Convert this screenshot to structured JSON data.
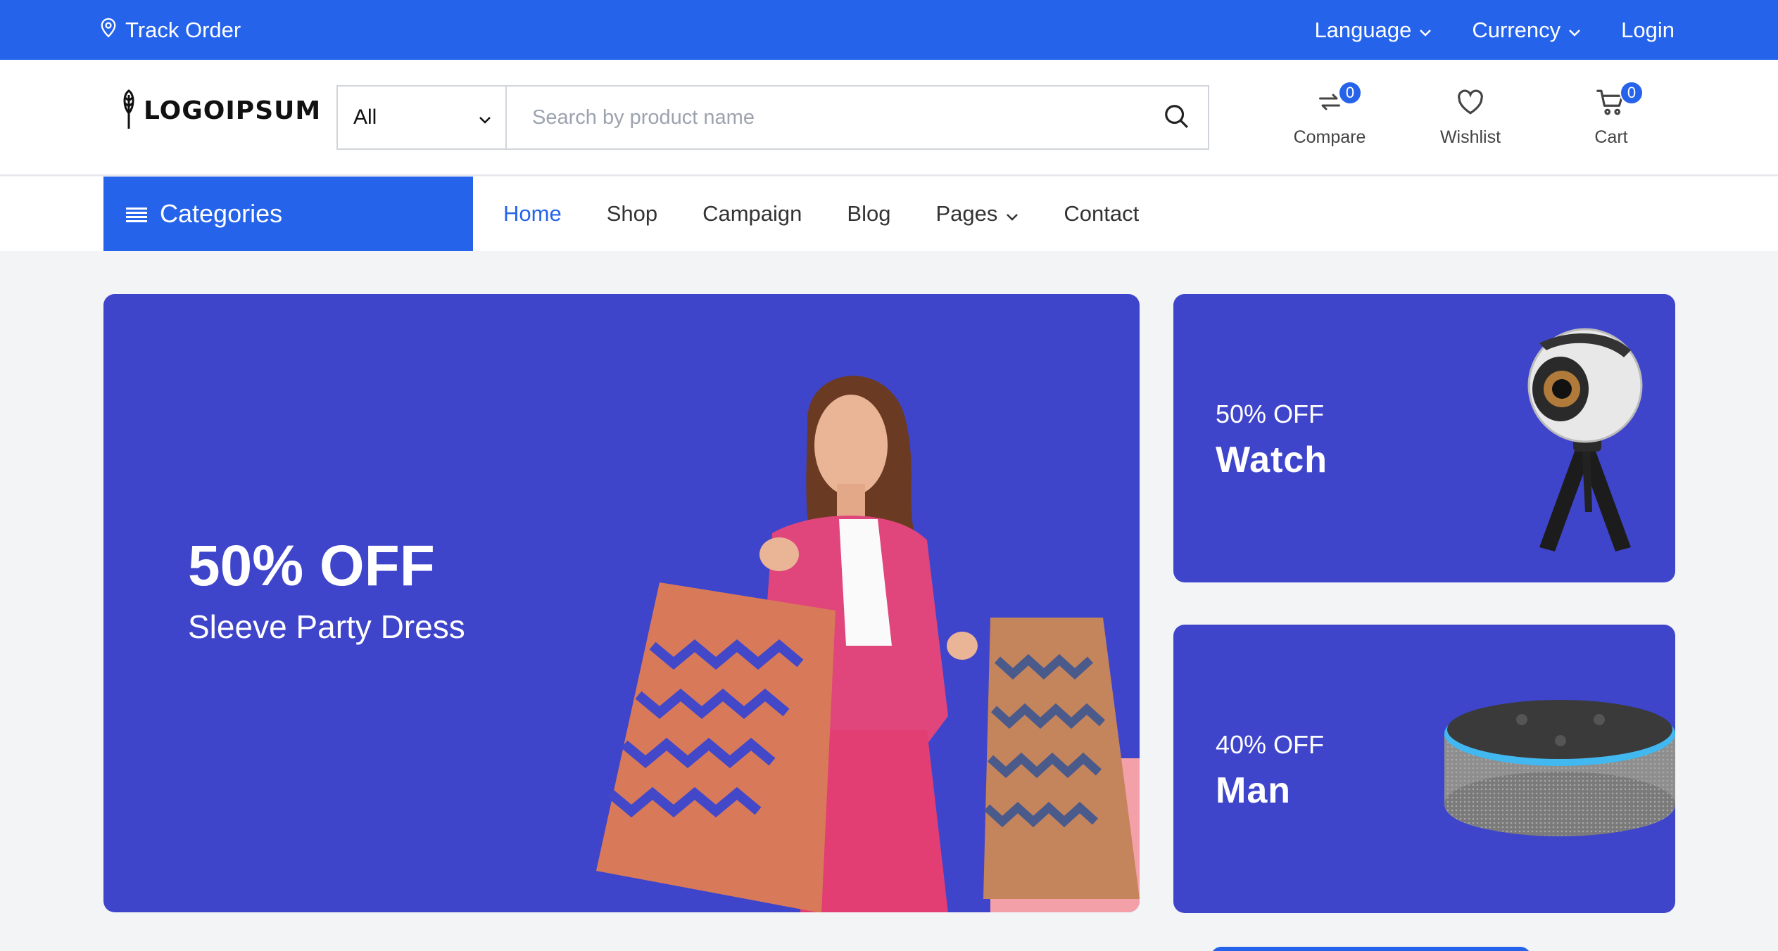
{
  "topbar": {
    "track_order": "Track Order",
    "language": "Language",
    "currency": "Currency",
    "login": "Login"
  },
  "header": {
    "logo_text": "LOGOIPSUM",
    "search": {
      "category": "All",
      "placeholder": "Search by product name"
    },
    "compare": {
      "label": "Compare",
      "count": "0"
    },
    "wishlist": {
      "label": "Wishlist"
    },
    "cart": {
      "label": "Cart",
      "count": "0"
    }
  },
  "nav": {
    "categories": "Categories",
    "items": [
      {
        "label": "Home"
      },
      {
        "label": "Shop"
      },
      {
        "label": "Campaign"
      },
      {
        "label": "Blog"
      },
      {
        "label": "Pages"
      },
      {
        "label": "Contact"
      }
    ]
  },
  "banners": {
    "main": {
      "discount": "50% OFF",
      "title": "Sleeve Party Dress"
    },
    "side": [
      {
        "discount": "50% OFF",
        "title": "Watch"
      },
      {
        "discount": "40% OFF",
        "title": "Man"
      }
    ]
  },
  "colors": {
    "brand": "#2563eb",
    "banner": "#3f45cb",
    "jacket": "#e0457b"
  },
  "icons": [
    "location-pin-icon",
    "chevron-down-icon",
    "search-icon",
    "compare-icon",
    "heart-icon",
    "cart-icon",
    "menu-icon"
  ]
}
